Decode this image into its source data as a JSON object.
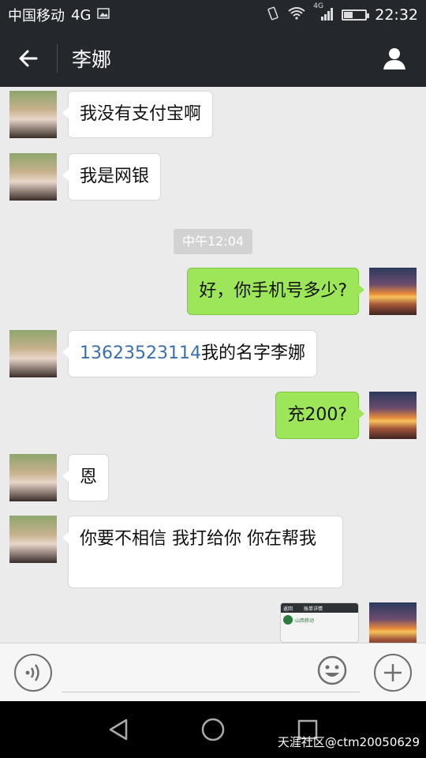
{
  "status_bar": {
    "carrier": "中国移动",
    "network": "4G",
    "network_small": "4G",
    "time": "22:32",
    "battery_level": 0.4
  },
  "header": {
    "title": "李娜",
    "back_icon": "back-arrow-icon",
    "profile_icon": "person-icon"
  },
  "messages": [
    {
      "side": "left",
      "text": "我没有支付宝啊"
    },
    {
      "side": "left",
      "text": "我是网银"
    },
    {
      "side": "time",
      "text": "中午12:04"
    },
    {
      "side": "right",
      "text": "好，你手机号多少?"
    },
    {
      "side": "left",
      "phone": "13623523114",
      "text": "我的名字李娜"
    },
    {
      "side": "right",
      "text": "充200?"
    },
    {
      "side": "left",
      "text": "恩"
    },
    {
      "side": "left",
      "text": "你要不相信  我打给你  你在帮我"
    },
    {
      "side": "right",
      "type": "image",
      "image_header": "账单详情",
      "image_header_left": "返回",
      "image_body": "山西移动"
    }
  ],
  "input_bar": {
    "placeholder": "",
    "voice_icon": "voice-icon",
    "emoji_icon": "emoji-icon",
    "plus_icon": "plus-icon"
  },
  "nav_bar": {
    "back_icon": "nav-back-icon",
    "home_icon": "nav-home-icon",
    "recent_icon": "nav-recent-icon"
  },
  "watermark": "天涯社区@ctm20050629",
  "colors": {
    "header_bg": "#24272c",
    "chat_bg": "#ebebeb",
    "bubble_self": "#9ee659",
    "bubble_other": "#ffffff",
    "phone_link": "#3a6fb0"
  }
}
